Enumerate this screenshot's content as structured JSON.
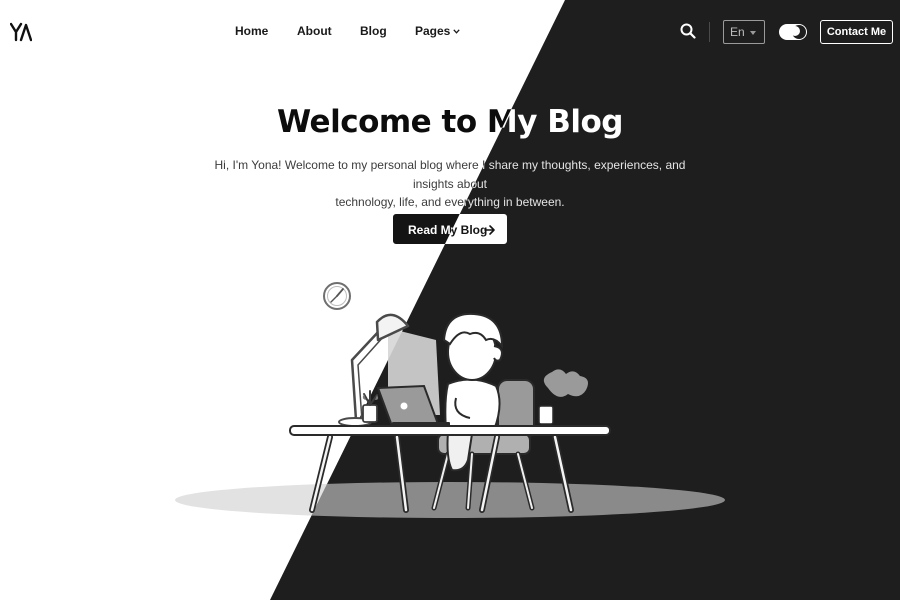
{
  "header": {
    "logo": "YA",
    "nav": {
      "home": "Home",
      "about": "About",
      "blog": "Blog",
      "pages": "Pages"
    },
    "language": "En",
    "contact_label": "Contact Me",
    "icons": [
      "search-icon",
      "chevron-down-icon",
      "theme-toggle-moon-icon"
    ]
  },
  "hero": {
    "title": "Welcome to My Blog",
    "text_line1": "Hi, I'm Yona! Welcome to my personal blog where I share my thoughts, experiences, and insights about",
    "text_line2": "technology, life, and everything in between.",
    "cta_label": "Read My Blog"
  },
  "colors": {
    "light_bg": "#ffffff",
    "dark_bg": "#1e1e1e",
    "accent": "#141414"
  }
}
